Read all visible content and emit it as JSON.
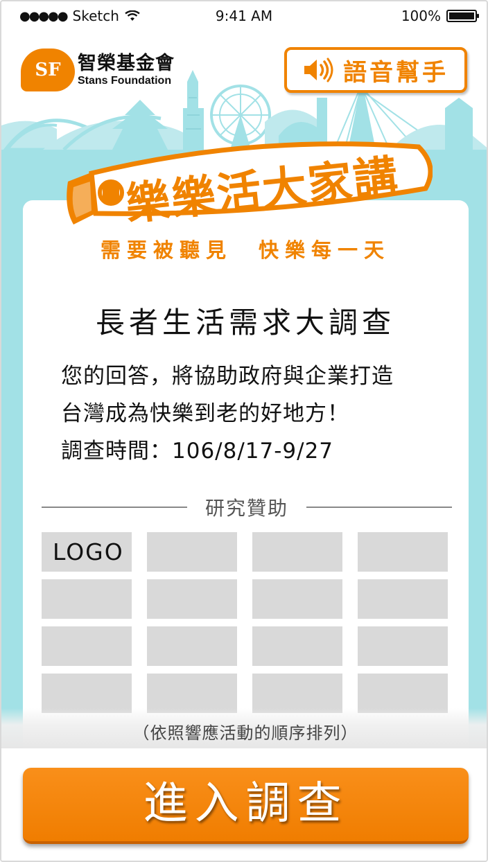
{
  "status_bar": {
    "signal": "●●●●●",
    "carrier": "Sketch",
    "time": "9:41 AM",
    "battery": "100%"
  },
  "header": {
    "logo_badge": "SF",
    "logo_name": "智榮基金會",
    "logo_name_en": "Stans Foundation",
    "voice_button_label": "語音幫手"
  },
  "banner": {
    "title": "樂樂活大家講",
    "slogan": "需要被聽見　快樂每一天"
  },
  "survey": {
    "title": "長者生活需求大調查",
    "desc_line1": "您的回答，將協助政府與企業打造",
    "desc_line2": "台灣成為快樂到老的好地方！",
    "desc_line3": "調查時間：106/8/17-9/27"
  },
  "sponsors": {
    "heading": "研究贊助",
    "first_logo": "LOGO",
    "order_note": "（依照響應活動的順序排列）"
  },
  "cta": {
    "label": "進入調查"
  },
  "colors": {
    "accent": "#f08300",
    "teal": "#a2e1e6",
    "placeholder": "#d9d9d9"
  }
}
